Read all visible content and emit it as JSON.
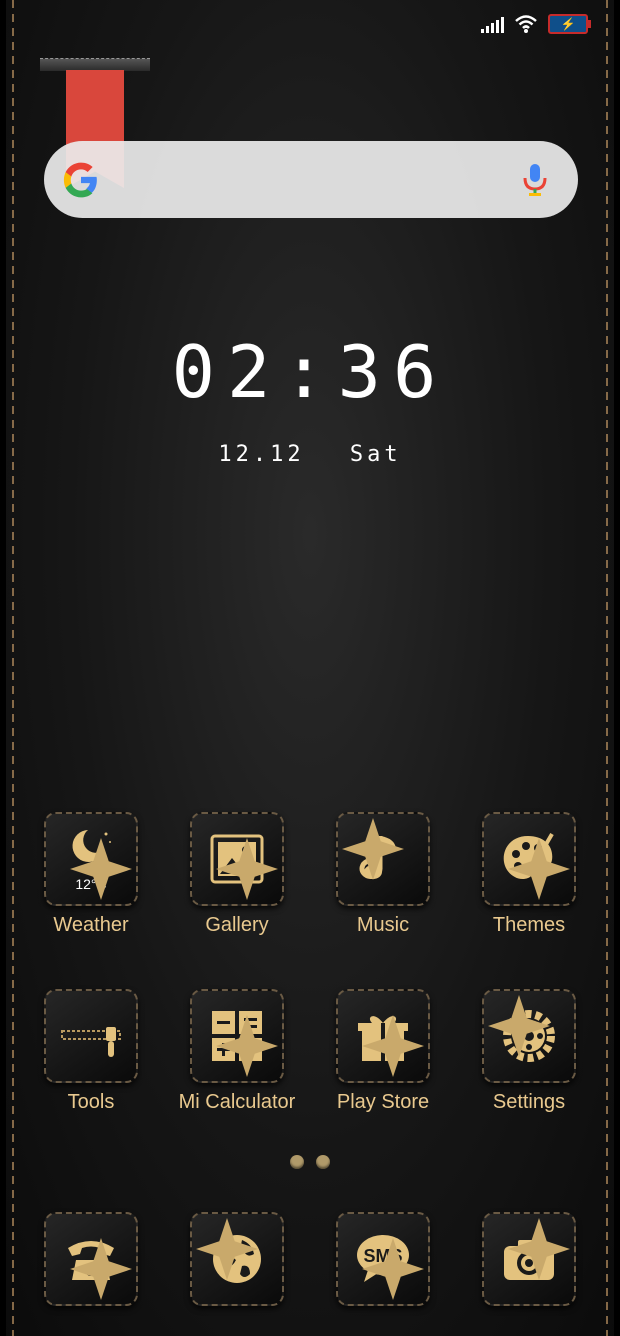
{
  "status": {
    "battery_glyph": "⚡"
  },
  "search": {
    "brand": "G"
  },
  "clock": {
    "time": "02:36",
    "date": "12.12",
    "weekday": "Sat"
  },
  "apps_row1": [
    {
      "label": "Weather",
      "sub": "12°C",
      "icon": "weather-moon-icon"
    },
    {
      "label": "Gallery",
      "icon": "gallery-icon"
    },
    {
      "label": "Music",
      "icon": "music-note-icon"
    },
    {
      "label": "Themes",
      "icon": "palette-icon"
    }
  ],
  "apps_row2": [
    {
      "label": "Tools",
      "icon": "zipper-icon"
    },
    {
      "label": "Mi Calculator",
      "icon": "calculator-icon"
    },
    {
      "label": "Play Store",
      "icon": "gift-icon"
    },
    {
      "label": "Settings",
      "icon": "gear-icon"
    }
  ],
  "dock": [
    {
      "icon": "phone-icon"
    },
    {
      "icon": "globe-icon"
    },
    {
      "icon": "sms-icon",
      "text": "SMS"
    },
    {
      "icon": "camera-icon"
    }
  ],
  "colors": {
    "gold": "#e3c27e",
    "bg": "#151515",
    "bookmark": "#d9473c"
  }
}
